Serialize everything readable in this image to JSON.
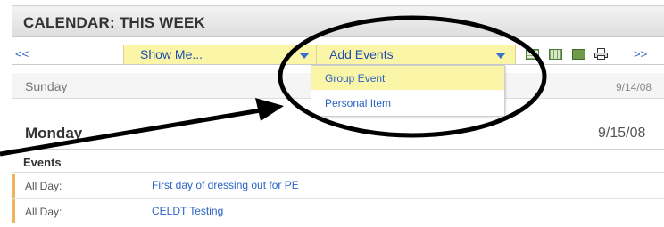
{
  "header": {
    "title": "CALENDAR: THIS WEEK"
  },
  "toolbar": {
    "prev_label": "<<",
    "next_label": ">>",
    "show_me_label": "Show Me...",
    "add_events_label": "Add Events",
    "view_icons": [
      "day-view-icon",
      "week-view-icon",
      "month-view-icon",
      "print-icon"
    ]
  },
  "add_menu": {
    "items": [
      "Group Event",
      "Personal Item"
    ]
  },
  "days": [
    {
      "name": "Sunday",
      "date": "9/14/08"
    },
    {
      "name": "Monday",
      "date": "9/15/08"
    }
  ],
  "events_section": {
    "label": "Events",
    "rows": [
      {
        "time": "All Day:",
        "title": "First day of dressing out for PE"
      },
      {
        "time": "All Day:",
        "title": "CELDT Testing"
      }
    ]
  },
  "colors": {
    "accent_yellow": "#fbf5a8",
    "link_blue": "#2b63c4",
    "event_bar": "#f0b35a"
  }
}
